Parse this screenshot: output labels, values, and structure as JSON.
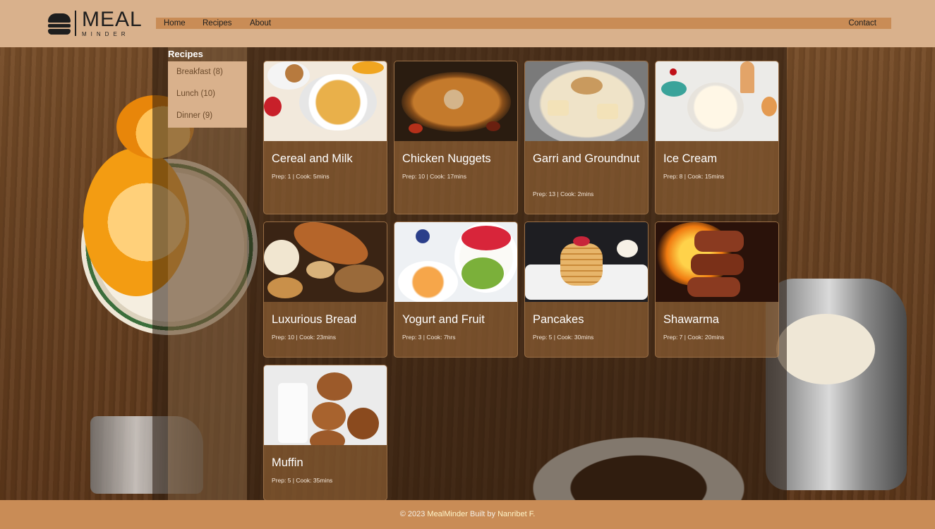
{
  "header": {
    "logo": {
      "main": "MEAL",
      "sub": "MINDER"
    },
    "nav": {
      "home": "Home",
      "recipes": "Recipes",
      "about": "About",
      "contact": "Contact"
    }
  },
  "sidebar": {
    "title": "Recipes",
    "items": [
      {
        "label": "Breakfast (8)"
      },
      {
        "label": "Lunch (10)"
      },
      {
        "label": "Dinner (9)"
      }
    ]
  },
  "recipes": [
    {
      "title": "Cereal and Milk",
      "meta": "Prep: 1 | Cook: 5mins"
    },
    {
      "title": "Chicken Nuggets",
      "meta": "Prep: 10 | Cook: 17mins"
    },
    {
      "title": "Garri and Groundnut",
      "meta": "Prep: 13 | Cook: 2mins"
    },
    {
      "title": "Ice Cream",
      "meta": "Prep: 8 | Cook: 15mins"
    },
    {
      "title": "Luxurious Bread",
      "meta": "Prep: 10 | Cook: 23mins"
    },
    {
      "title": "Yogurt and Fruit",
      "meta": "Prep: 3 | Cook: 7hrs"
    },
    {
      "title": "Pancakes",
      "meta": "Prep: 5 | Cook: 30mins"
    },
    {
      "title": "Shawarma",
      "meta": "Prep: 7 | Cook: 20mins"
    },
    {
      "title": "Muffin",
      "meta": "Prep: 5 | Cook: 35mins"
    }
  ],
  "footer": {
    "prefix": "© 2023",
    "brand": "MealMinder",
    "built_by": "Built by",
    "author": "Nanribet F."
  },
  "colors": {
    "header_bg": "#d9b18c",
    "nav_bg": "#c98c56",
    "footer_bg": "#c98c56",
    "brand_text": "#1e1e1e"
  }
}
